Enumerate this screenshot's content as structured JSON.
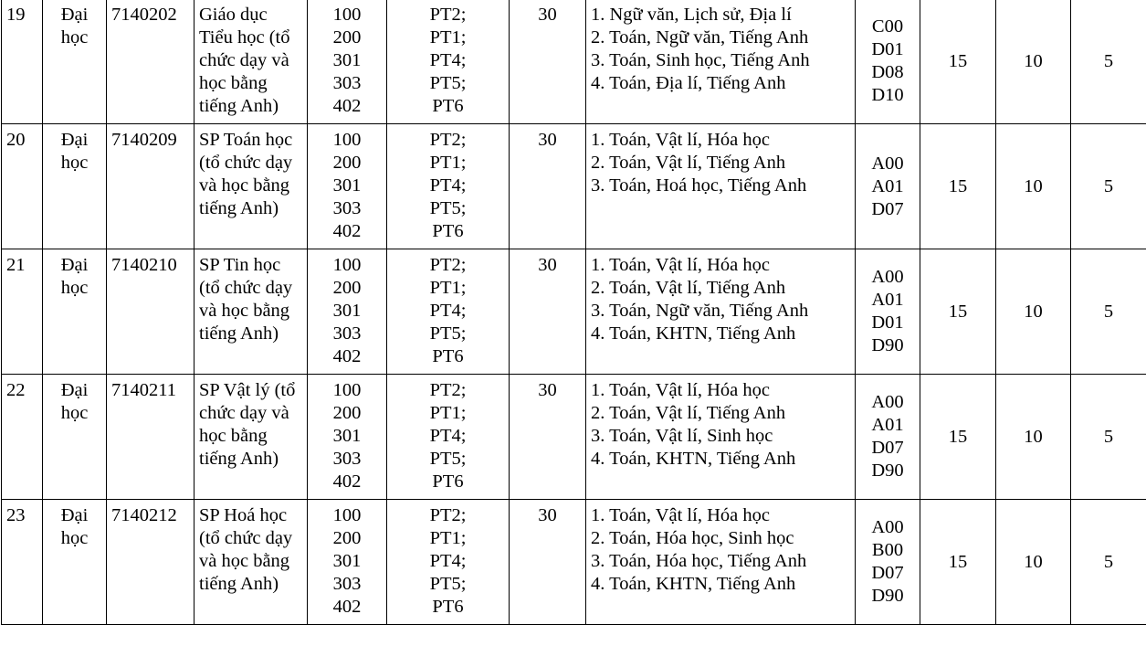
{
  "rows": [
    {
      "stt": "19",
      "level": [
        "Đại",
        "học"
      ],
      "code": "7140202",
      "name": "Giáo dục Tiểu học (tổ chức dạy và học bằng tiếng Anh)",
      "method_codes": [
        "100",
        "200",
        "301",
        "303",
        "402"
      ],
      "methods": [
        "PT2;",
        "PT1;",
        "PT4;",
        "PT5;",
        "PT6"
      ],
      "quota": "30",
      "combos": [
        "1. Ngữ văn, Lịch sử, Địa lí",
        "2. Toán, Ngữ văn, Tiếng Anh",
        "3. Toán, Sinh học, Tiếng Anh",
        "4. Toán, Địa lí, Tiếng Anh"
      ],
      "combo_codes": [
        "C00",
        "D01",
        "D08",
        "D10"
      ],
      "v1": "15",
      "v2": "10",
      "v3": "5"
    },
    {
      "stt": "20",
      "level": [
        "Đại",
        "học"
      ],
      "code": "7140209",
      "name": "SP Toán học (tổ chức dạy và học bằng tiếng Anh)",
      "method_codes": [
        "100",
        "200",
        "301",
        "303",
        "402"
      ],
      "methods": [
        "PT2;",
        "PT1;",
        "PT4;",
        "PT5;",
        "PT6"
      ],
      "quota": "30",
      "combos": [
        "1. Toán, Vật lí, Hóa học",
        "2. Toán, Vật lí, Tiếng Anh",
        "3. Toán, Hoá học, Tiếng Anh"
      ],
      "combo_codes": [
        "A00",
        "A01",
        "D07"
      ],
      "v1": "15",
      "v2": "10",
      "v3": "5"
    },
    {
      "stt": "21",
      "level": [
        "Đại",
        "học"
      ],
      "code": "7140210",
      "name": "SP Tin học (tổ chức dạy và học bằng tiếng Anh)",
      "method_codes": [
        "100",
        "200",
        "301",
        "303",
        "402"
      ],
      "methods": [
        "PT2;",
        "PT1;",
        "PT4;",
        "PT5;",
        "PT6"
      ],
      "quota": "30",
      "combos": [
        "1. Toán, Vật lí, Hóa học",
        "2. Toán, Vật lí, Tiếng Anh",
        "3. Toán, Ngữ văn, Tiếng Anh",
        "4. Toán, KHTN, Tiếng Anh"
      ],
      "combo_codes": [
        "A00",
        "A01",
        "D01",
        "D90"
      ],
      "v1": "15",
      "v2": "10",
      "v3": "5"
    },
    {
      "stt": "22",
      "level": [
        "Đại",
        "học"
      ],
      "code": "7140211",
      "name": "SP Vật lý (tổ chức dạy và học bằng tiếng Anh)",
      "method_codes": [
        "100",
        "200",
        "301",
        "303",
        "402"
      ],
      "methods": [
        "PT2;",
        "PT1;",
        "PT4;",
        "PT5;",
        "PT6"
      ],
      "quota": "30",
      "combos": [
        "1. Toán, Vật lí, Hóa học",
        "2. Toán, Vật lí, Tiếng Anh",
        "3. Toán, Vật lí, Sinh học",
        "4. Toán, KHTN, Tiếng Anh"
      ],
      "combo_codes": [
        "A00",
        "A01",
        "D07",
        "D90"
      ],
      "v1": "15",
      "v2": "10",
      "v3": "5"
    },
    {
      "stt": "23",
      "level": [
        "Đại",
        "học"
      ],
      "code": "7140212",
      "name": "SP Hoá học (tổ chức dạy và học bằng tiếng Anh)",
      "method_codes": [
        "100",
        "200",
        "301",
        "303",
        "402"
      ],
      "methods": [
        "PT2;",
        "PT1;",
        "PT4;",
        "PT5;",
        "PT6"
      ],
      "quota": "30",
      "combos": [
        "1. Toán, Vật lí, Hóa học",
        "2. Toán, Hóa học, Sinh học",
        "3. Toán, Hóa học, Tiếng Anh",
        "4. Toán, KHTN, Tiếng Anh"
      ],
      "combo_codes": [
        "A00",
        "B00",
        "D07",
        "D90"
      ],
      "v1": "15",
      "v2": "10",
      "v3": "5"
    }
  ]
}
